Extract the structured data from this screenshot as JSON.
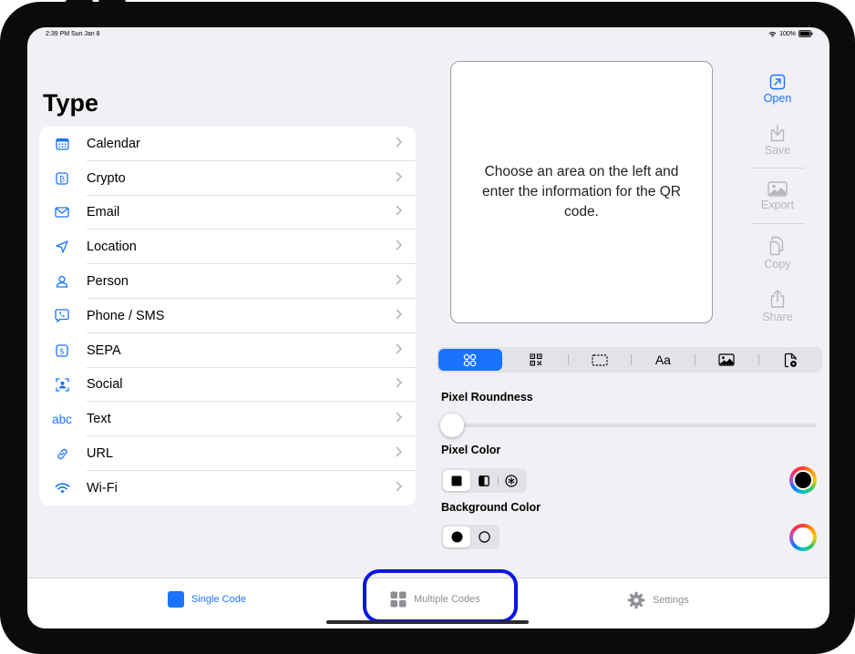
{
  "status_bar": {
    "time": "2:39 PM  Sun Jan 8",
    "battery": "100%"
  },
  "type_panel": {
    "title": "Type",
    "items": [
      {
        "label": "Calendar",
        "icon": "calendar-icon"
      },
      {
        "label": "Crypto",
        "icon": "bitcoin-icon"
      },
      {
        "label": "Email",
        "icon": "envelope-icon"
      },
      {
        "label": "Location",
        "icon": "location-arrow-icon"
      },
      {
        "label": "Person",
        "icon": "person-icon"
      },
      {
        "label": "Phone / SMS",
        "icon": "phone-bubble-icon"
      },
      {
        "label": "SEPA",
        "icon": "dollar-icon"
      },
      {
        "label": "Social",
        "icon": "person-frame-icon"
      },
      {
        "label": "Text",
        "icon": "abc-icon",
        "icon_text": "abc"
      },
      {
        "label": "URL",
        "icon": "link-icon"
      },
      {
        "label": "Wi-Fi",
        "icon": "wifi-icon"
      }
    ]
  },
  "preview": {
    "message": "Choose an area on the left and enter the information for the QR code."
  },
  "side_toolbar": {
    "open": "Open",
    "save": "Save",
    "export": "Export",
    "copy": "Copy",
    "share": "Share"
  },
  "style_tabs": {
    "font_label": "Aa",
    "selected_index": 0
  },
  "options": {
    "pixel_roundness_label": "Pixel Roundness",
    "pixel_roundness_value": 0,
    "pixel_color_label": "Pixel Color",
    "background_color_label": "Background Color",
    "pixel_color": "#000000",
    "background_color": "#ffffff"
  },
  "tab_bar": {
    "single": "Single Code",
    "multiple": "Multiple Codes",
    "settings": "Settings"
  },
  "colors": {
    "accent": "#1a73ff",
    "highlight": "#0a14e6"
  }
}
